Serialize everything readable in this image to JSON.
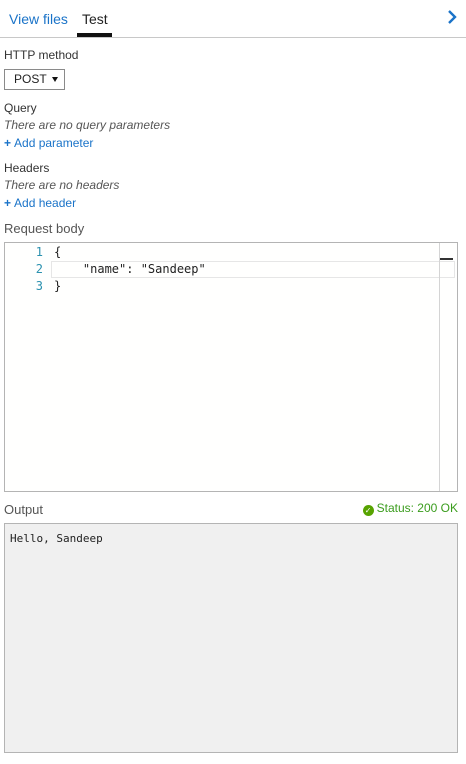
{
  "tabs": [
    {
      "label": "View files",
      "active": false
    },
    {
      "label": "Test",
      "active": true
    }
  ],
  "icons": {
    "collapse": "chevron-right-icon",
    "status": "check-circle-icon"
  },
  "colors": {
    "accent": "#1a73c8",
    "success": "#3a9c1d",
    "line_number": "#2b91af"
  },
  "http_method": {
    "label": "HTTP method",
    "value": "POST"
  },
  "query": {
    "label": "Query",
    "empty_text": "There are no query parameters",
    "add_label": "Add parameter"
  },
  "headers": {
    "label": "Headers",
    "empty_text": "There are no headers",
    "add_label": "Add header"
  },
  "request_body": {
    "label": "Request body",
    "lines": [
      {
        "number": "1",
        "code": "{"
      },
      {
        "number": "2",
        "code": "    \"name\": \"Sandeep\""
      },
      {
        "number": "3",
        "code": "}"
      }
    ]
  },
  "output": {
    "label": "Output",
    "status": "Status: 200 OK",
    "text": "Hello, Sandeep"
  }
}
